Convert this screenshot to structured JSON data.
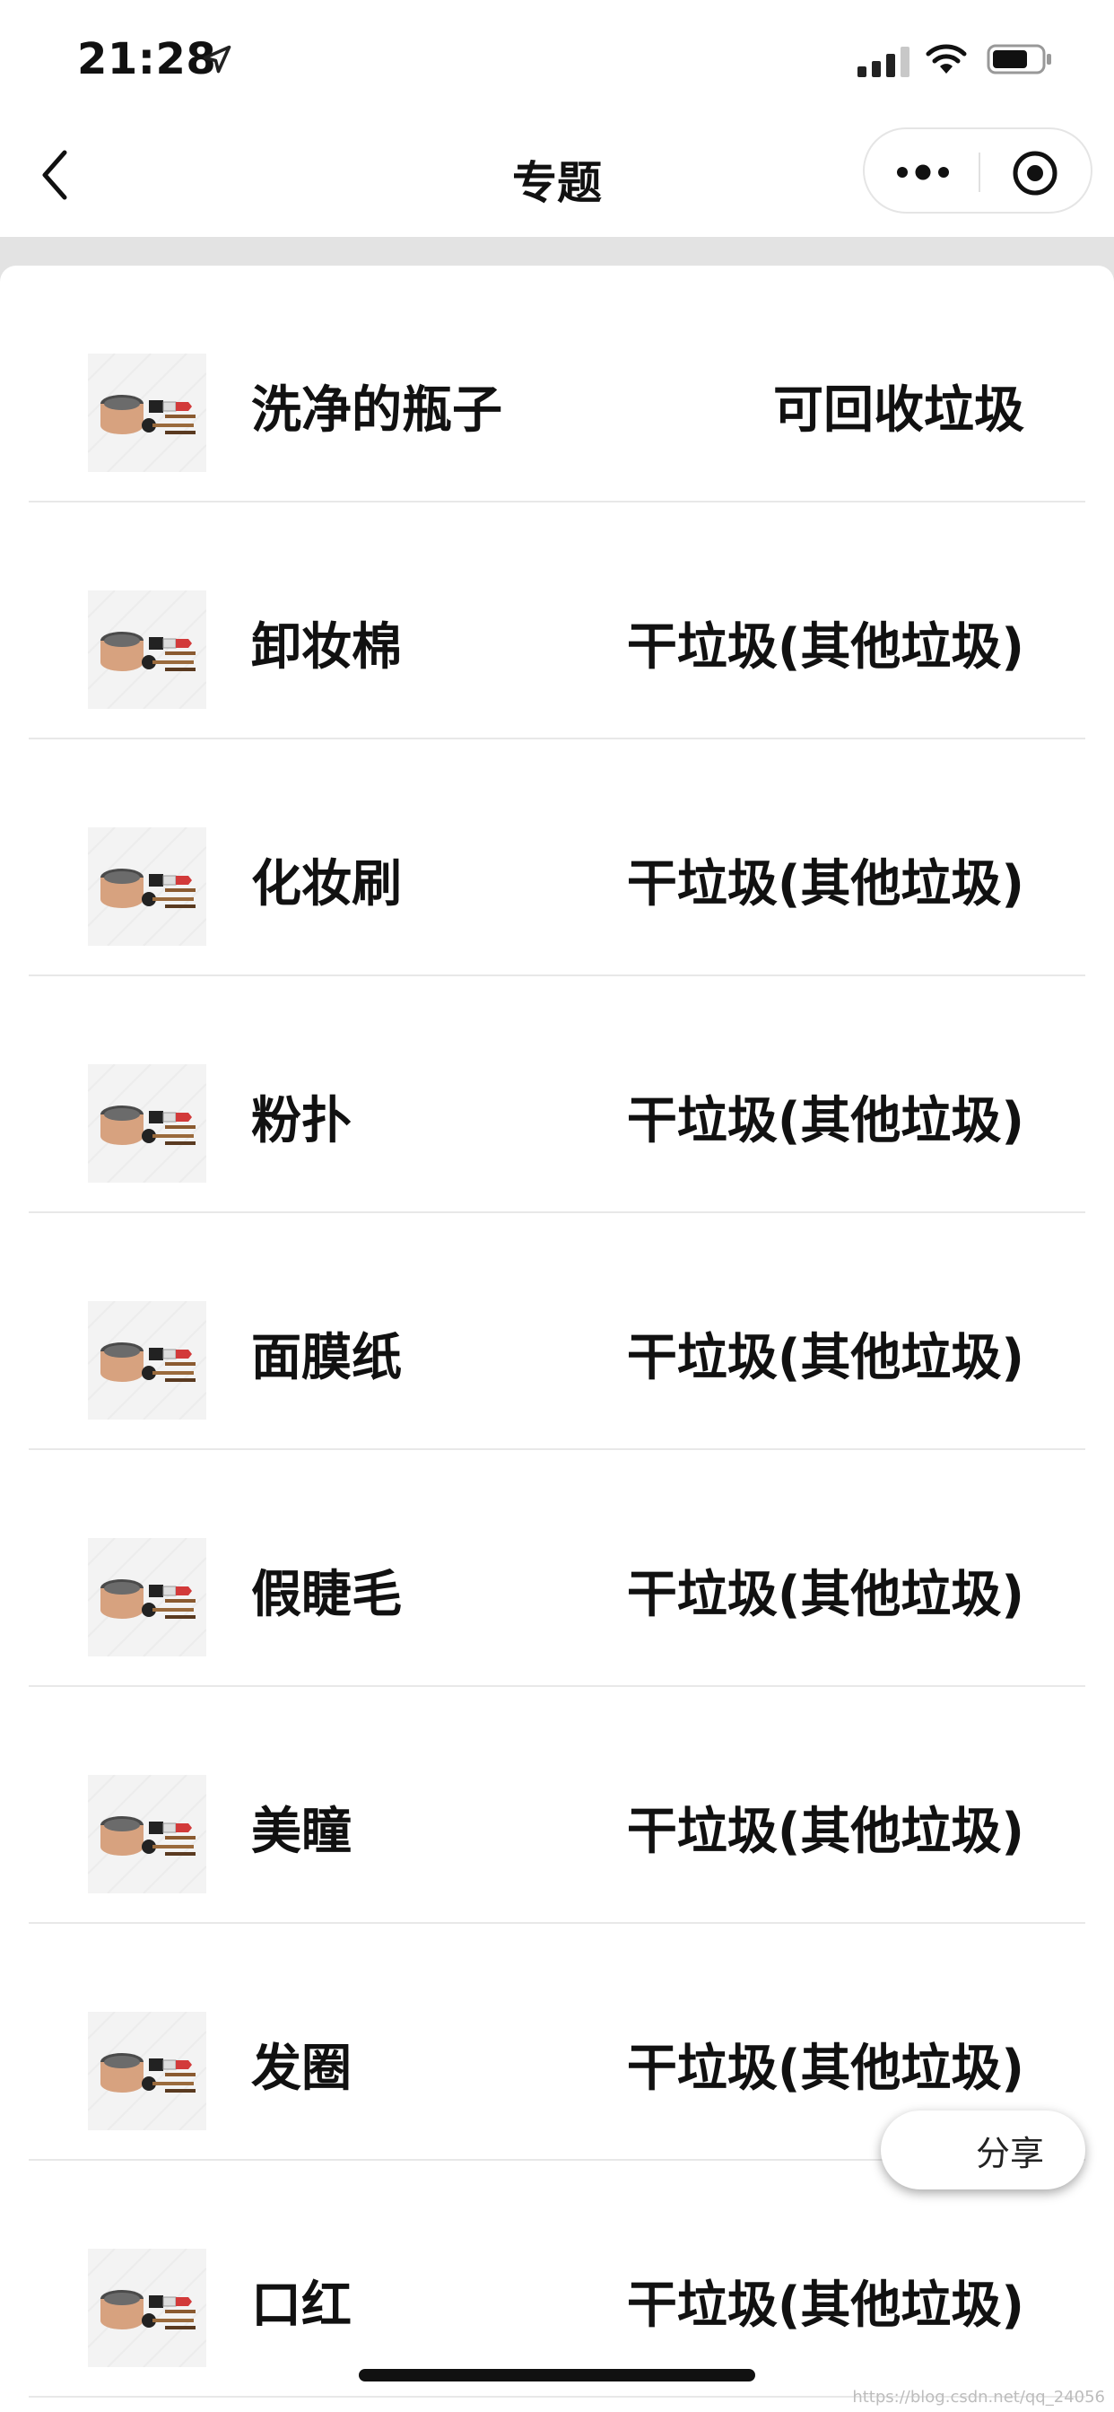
{
  "status_bar": {
    "time": "21:28"
  },
  "nav": {
    "title": "专题"
  },
  "items": [
    {
      "name": "洗净的瓶子",
      "category": "可回收垃圾"
    },
    {
      "name": "卸妆棉",
      "category": "干垃圾(其他垃圾)"
    },
    {
      "name": "化妆刷",
      "category": "干垃圾(其他垃圾)"
    },
    {
      "name": "粉扑",
      "category": "干垃圾(其他垃圾)"
    },
    {
      "name": "面膜纸",
      "category": "干垃圾(其他垃圾)"
    },
    {
      "name": "假睫毛",
      "category": "干垃圾(其他垃圾)"
    },
    {
      "name": "美瞳",
      "category": "干垃圾(其他垃圾)"
    },
    {
      "name": "发圈",
      "category": "干垃圾(其他垃圾)"
    },
    {
      "name": "口红",
      "category": "干垃圾(其他垃圾)"
    }
  ],
  "share": {
    "label": "分享"
  },
  "watermark": "https://blog.csdn.net/qq_24056"
}
